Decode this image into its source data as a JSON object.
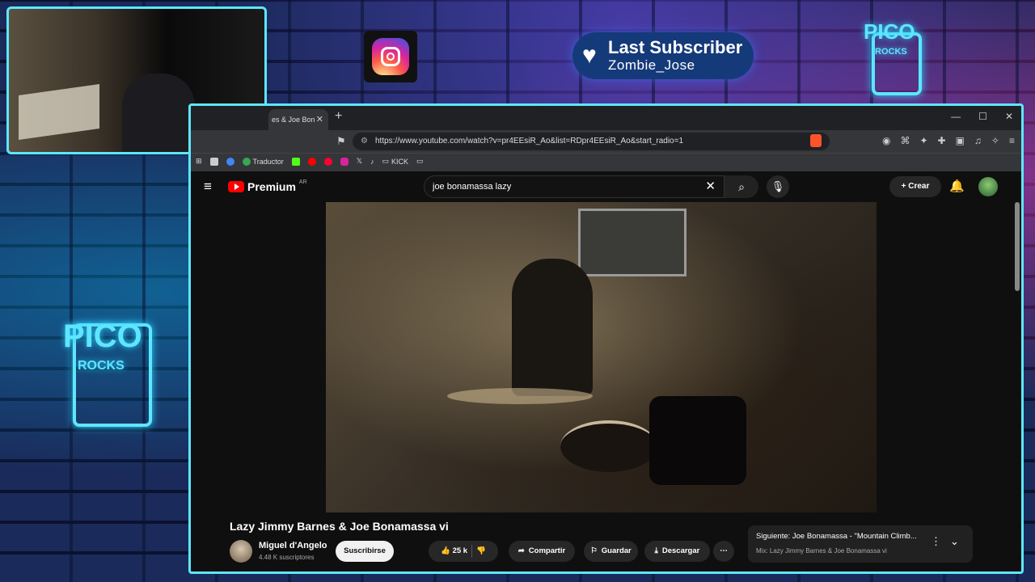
{
  "overlay": {
    "last_subscriber_title": "Last Subscriber",
    "last_subscriber_name": "Zombie_Jose",
    "brand_top": "PICO",
    "brand_top_sub": "ROCKS",
    "brand_side": "PICO",
    "brand_side_sub": "ROCKS"
  },
  "browser": {
    "tab_title": "es & Joe Bon",
    "url": "https://www.youtube.com/watch?v=pr4EEsiR_Ao&list=RDpr4EEsiR_Ao&start_radio=1",
    "bookmarks": [
      "Traductor",
      "KICK"
    ]
  },
  "youtube": {
    "logo": "Premium",
    "region": "AR",
    "search_value": "joe bonamassa lazy",
    "create_label": "Crear",
    "video_title": "Lazy Jimmy Barnes & Joe Bonamassa vi",
    "channel_name": "Miguel d'Angelo",
    "channel_subs": "4.48 K suscriptores",
    "subscribe_label": "Suscribirse",
    "likes": "25 k",
    "share_label": "Compartir",
    "save_label": "Guardar",
    "download_label": "Descargar",
    "next_title": "Siguiente: Joe Bonamassa - \"Mountain Climb...",
    "next_mix": "Mix: Lazy Jimmy Barnes & Joe Bonamassa vi"
  },
  "colors": {
    "overlay_border": "#5ee6ff",
    "yt_red": "#ff0000",
    "subscriber_badge": "#153a7a"
  }
}
